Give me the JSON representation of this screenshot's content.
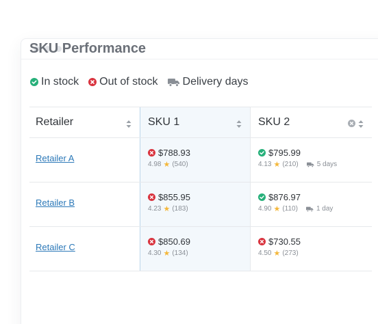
{
  "page": {
    "title": "SKU Performance"
  },
  "legend": {
    "in_stock": "In stock",
    "out_of_stock": "Out of stock",
    "delivery_days": "Delivery days"
  },
  "colors": {
    "in_stock": "#27b07a",
    "out_of_stock": "#d9343f",
    "star": "#f4b73a",
    "link": "#2b78b8"
  },
  "table": {
    "headers": {
      "retailer": "Retailer",
      "sku1": "SKU 1",
      "sku2": "SKU 2"
    },
    "rows": [
      {
        "retailer": "Retailer A",
        "sku1": {
          "stock": "out",
          "price": "$788.93",
          "rating": "4.98",
          "reviews": "(540)"
        },
        "sku2": {
          "stock": "in",
          "price": "$795.99",
          "rating": "4.13",
          "reviews": "(210)",
          "delivery": "5 days"
        }
      },
      {
        "retailer": "Retailer B",
        "sku1": {
          "stock": "out",
          "price": "$855.95",
          "rating": "4.23",
          "reviews": "(183)"
        },
        "sku2": {
          "stock": "in",
          "price": "$876.97",
          "rating": "4.90",
          "reviews": "(110)",
          "delivery": "1 day"
        }
      },
      {
        "retailer": "Retailer C",
        "sku1": {
          "stock": "out",
          "price": "$850.69",
          "rating": "4.30",
          "reviews": "(134)"
        },
        "sku2": {
          "stock": "out",
          "price": "$730.55",
          "rating": "4.50",
          "reviews": "(273)"
        }
      }
    ]
  }
}
